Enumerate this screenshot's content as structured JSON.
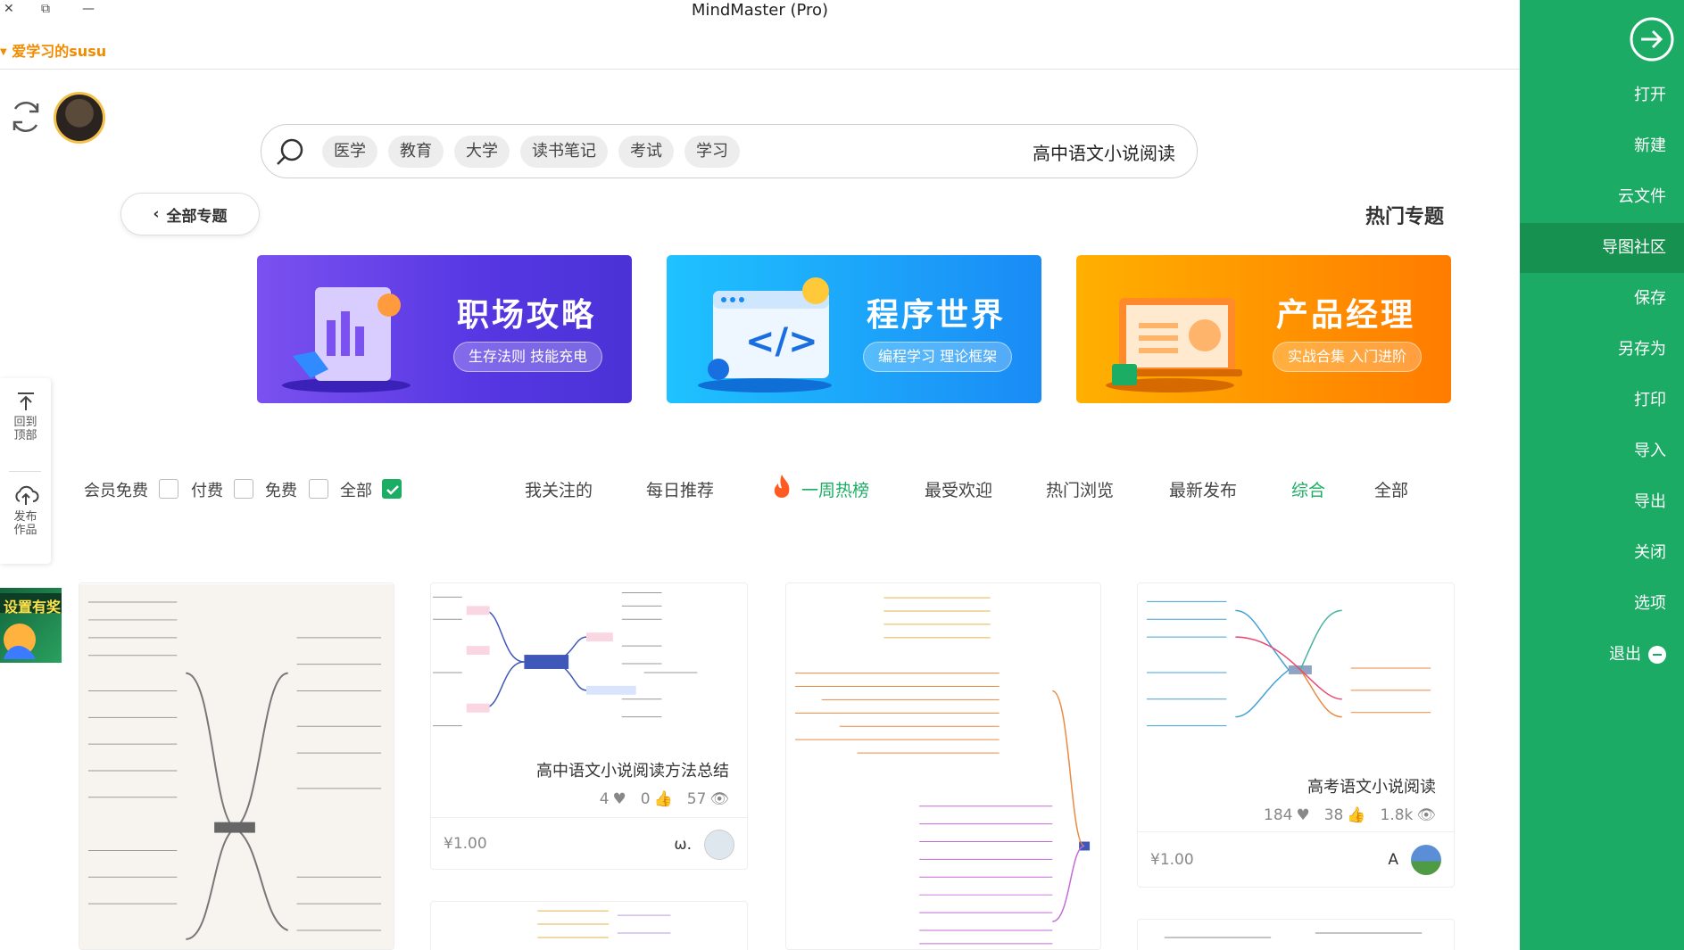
{
  "window": {
    "title": "MindMaster (Pro)",
    "close": "✕",
    "restore": "⧉",
    "minimize": "—"
  },
  "user": {
    "name": "爱学习的susu"
  },
  "search": {
    "value": "高中语文小说阅读",
    "tags": [
      "医学",
      "教育",
      "大学",
      "读书笔记",
      "考试",
      "学习"
    ]
  },
  "topics": {
    "all_label": "全部专题",
    "section_title": "热门专题"
  },
  "banners": [
    {
      "title": "职场攻略",
      "subtitle": "生存法则 技能充电"
    },
    {
      "title": "程序世界",
      "subtitle": "编程学习 理论框架"
    },
    {
      "title": "产品经理",
      "subtitle": "实战合集 入门进阶"
    }
  ],
  "float_panel": {
    "top_label_1": "回到",
    "top_label_2": "顶部",
    "publish_label_1": "发布",
    "publish_label_2": "作品"
  },
  "filters": {
    "tabs": [
      "全部",
      "综合",
      "最新发布",
      "热门浏览",
      "最受欢迎",
      "一周热榜",
      "每日推荐",
      "我关注的"
    ],
    "checks": [
      "全部",
      "免费",
      "付费",
      "会员免费"
    ]
  },
  "cards": [
    {
      "title": "高中语文小说阅读方法总结",
      "views": "57",
      "likes": "0",
      "hearts": "4",
      "author": "ω.",
      "price": "¥1.00"
    },
    {
      "title": "高考语文小说阅读",
      "views": "1.8k",
      "likes": "38",
      "hearts": "184",
      "author": "A",
      "price": "¥1.00"
    }
  ],
  "sidebar": {
    "items": [
      "打开",
      "新建",
      "云文件",
      "导图社区",
      "保存",
      "另存为",
      "打印",
      "导入",
      "导出",
      "关闭",
      "选项",
      "退出"
    ],
    "active": "导图社区"
  },
  "promo": {
    "text": "设置有奖"
  },
  "colors": {
    "accent": "#1cab64",
    "accent_dark": "#16914f",
    "user": "#f08c00"
  }
}
